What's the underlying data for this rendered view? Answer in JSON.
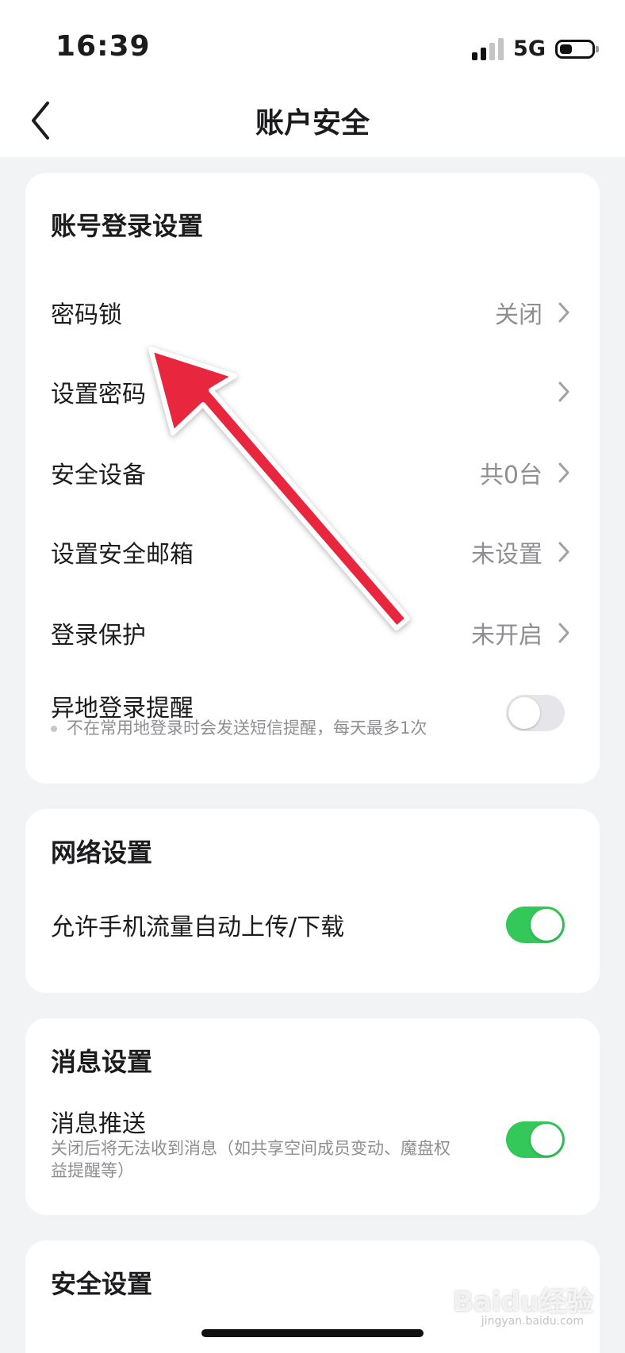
{
  "status_bar": {
    "time": "16:39",
    "network": "5G",
    "battery_level": 0.4
  },
  "header": {
    "title": "账户安全",
    "back_icon": "chevron-left-icon"
  },
  "sections": {
    "account_login": {
      "title": "账号登录设置",
      "rows": [
        {
          "label": "密码锁",
          "value": "关闭"
        },
        {
          "label": "设置密码",
          "value": ""
        },
        {
          "label": "安全设备",
          "value": "共0台"
        },
        {
          "label": "设置安全邮箱",
          "value": "未设置"
        },
        {
          "label": "登录保护",
          "value": "未开启"
        }
      ],
      "remote_login": {
        "label": "异地登录提醒",
        "description": "不在常用地登录时会发送短信提醒，每天最多1次",
        "enabled": false
      }
    },
    "network": {
      "title": "网络设置",
      "cellular_transfer": {
        "label": "允许手机流量自动上传/下载",
        "enabled": true
      }
    },
    "messages": {
      "title": "消息设置",
      "push": {
        "label": "消息推送",
        "description_line1": "关闭后将无法收到消息（如共享空间成员变动、魔盘权",
        "description_line2": "益提醒等）",
        "enabled": true
      }
    },
    "security": {
      "title": "安全设置"
    }
  },
  "overlay": {
    "arrow_color": "#e8283c",
    "watermark": "Baidu经验",
    "watermark_sub": "jingyan.baidu.com"
  },
  "colors": {
    "toggle_on": "#34c759",
    "toggle_off": "#e6e6ea",
    "secondary_text": "#8e8e93"
  }
}
